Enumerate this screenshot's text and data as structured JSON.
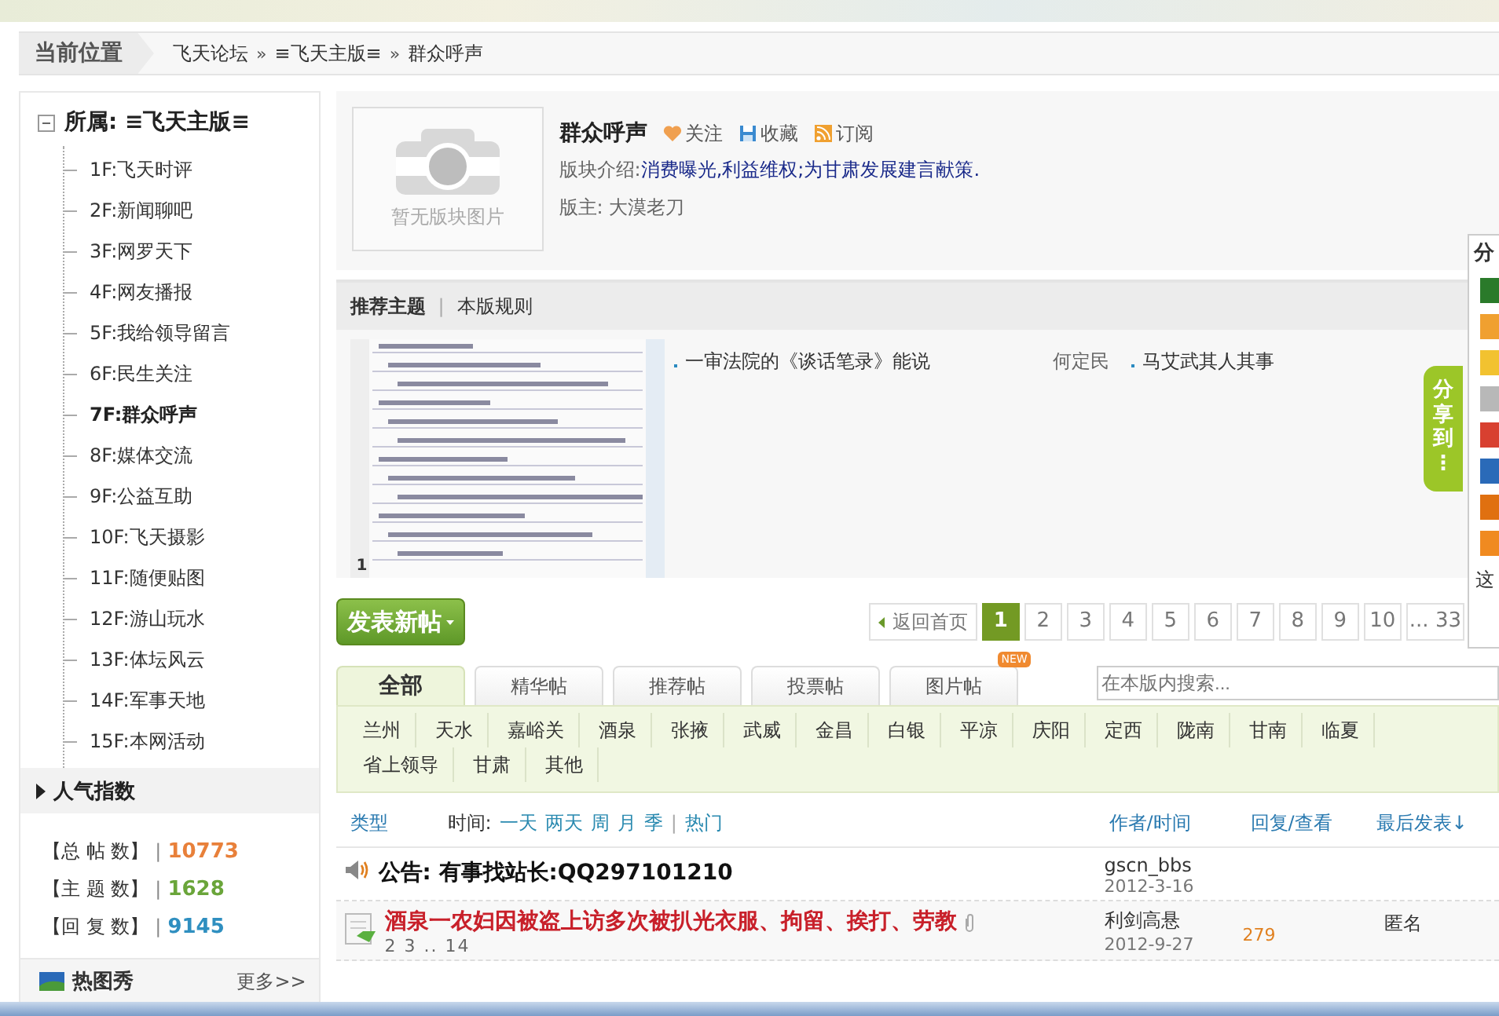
{
  "breadcrumb": {
    "label": "当前位置",
    "crumbs": [
      {
        "kind": "link",
        "text": "飞天论坛"
      },
      {
        "kind": "separator",
        "text": "»"
      },
      {
        "kind": "link",
        "text": "≡飞天主版≡"
      },
      {
        "kind": "separator",
        "text": "»"
      },
      {
        "kind": "link",
        "text": "群众呼声"
      }
    ]
  },
  "sidebar": {
    "title": "所属: ≡飞天主版≡",
    "expanded": true,
    "items": [
      {
        "label": "1F:飞天时评",
        "selected": false
      },
      {
        "label": "2F:新闻聊吧",
        "selected": false
      },
      {
        "label": "3F:网罗天下",
        "selected": false
      },
      {
        "label": "4F:网友播报",
        "selected": false
      },
      {
        "label": "5F:我给领导留言",
        "selected": false
      },
      {
        "label": "6F:民生关注",
        "selected": false
      },
      {
        "label": "7F:群众呼声",
        "selected": true
      },
      {
        "label": "8F:媒体交流",
        "selected": false
      },
      {
        "label": "9F:公益互助",
        "selected": false
      },
      {
        "label": "10F:飞天摄影",
        "selected": false
      },
      {
        "label": "11F:随便贴图",
        "selected": false
      },
      {
        "label": "12F:游山玩水",
        "selected": false
      },
      {
        "label": "13F:体坛风云",
        "selected": false
      },
      {
        "label": "14F:军事天地",
        "selected": false
      },
      {
        "label": "15F:本网活动",
        "selected": false
      }
    ]
  },
  "popularity": {
    "title": "人气指数",
    "expanded": false,
    "stats": [
      {
        "label": "【总 帖 数】",
        "separator": "|",
        "value": "10773",
        "color": "#e8803a"
      },
      {
        "label": "【主 题 数】",
        "separator": "|",
        "value": "1628",
        "color": "#6aa53a"
      },
      {
        "label": "【回 复 数】",
        "separator": "|",
        "value": "9145",
        "color": "#2f8fc0"
      }
    ]
  },
  "hot_pics": {
    "title": "热图秀",
    "more": "更多>>"
  },
  "forum": {
    "image_caption": "暂无版块图片",
    "name": "群众呼声",
    "actions": [
      {
        "kind": "heart",
        "label": "关注"
      },
      {
        "kind": "disk",
        "label": "收藏"
      },
      {
        "kind": "rss",
        "label": "订阅"
      }
    ],
    "intro_label": "版块介绍:",
    "intro": "消费曝光,利益维权;为甘肃发展建言献策.",
    "moderator": "版主: 大漠老刀"
  },
  "recommend": {
    "tab_separator": "|",
    "tabs": [
      {
        "label": "推荐主题",
        "selected": true
      },
      {
        "label": "本版规则",
        "selected": false
      }
    ],
    "image_index": "1",
    "topics": [
      {
        "title": "一审法院的《谈话笔录》能说",
        "author": "何定民"
      },
      {
        "title": "马艾武其人其事"
      }
    ]
  },
  "post_button": "发表新帖",
  "pager": {
    "back": "返回首页",
    "pages": [
      {
        "label": "1",
        "selected": true
      },
      {
        "label": "2",
        "selected": false
      },
      {
        "label": "3",
        "selected": false
      },
      {
        "label": "4",
        "selected": false
      },
      {
        "label": "5",
        "selected": false
      },
      {
        "label": "6",
        "selected": false
      },
      {
        "label": "7",
        "selected": false
      },
      {
        "label": "8",
        "selected": false
      },
      {
        "label": "9",
        "selected": false
      },
      {
        "label": "10",
        "selected": false
      },
      {
        "label": "... 33",
        "selected": false
      }
    ]
  },
  "filter_tabs": [
    {
      "label": "全部",
      "selected": true
    },
    {
      "label": "精华帖",
      "selected": false
    },
    {
      "label": "推荐帖",
      "selected": false
    },
    {
      "label": "投票帖",
      "selected": false
    },
    {
      "label": "图片帖",
      "selected": false,
      "badge": "NEW"
    }
  ],
  "search": {
    "placeholder": "在本版内搜索..."
  },
  "regions": [
    "兰州",
    "天水",
    "嘉峪关",
    "酒泉",
    "张掖",
    "武威",
    "金昌",
    "白银",
    "平凉",
    "庆阳",
    "定西",
    "陇南",
    "甘南",
    "临夏",
    "省上领导",
    "甘肃",
    "其他"
  ],
  "list_header": {
    "type": "类型",
    "time_label": "时间:",
    "time_filters": [
      "一天",
      "两天",
      "周",
      "月",
      "季"
    ],
    "separator": "|",
    "hot": "热门",
    "author_time": "作者/时间",
    "replies_views": "回复/查看",
    "last_post": "最后发表↓"
  },
  "threads": [
    {
      "kind": "announcement",
      "title": "公告: 有事找站长:QQ297101210",
      "author": "gscn_bbs",
      "date": "2012-3-16"
    },
    {
      "kind": "topic",
      "title": "酒泉一农妇因被盗上访多次被扒光衣服、拘留、挨打、劳教",
      "pages": "2 3 .. 14",
      "attachment": true,
      "author": "利剑高悬",
      "date": "2012-9-27",
      "replies": "279",
      "last_author": "匿名"
    }
  ],
  "share": {
    "title": "分",
    "tab": "分享到⋮",
    "footer": "这",
    "services": [
      {
        "color": "#2a7a2a"
      },
      {
        "color": "#f0a030"
      },
      {
        "color": "#f2c230"
      },
      {
        "color": "#b8b8b8"
      },
      {
        "color": "#d84030"
      },
      {
        "color": "#2a6ab8"
      },
      {
        "color": "#e07010"
      },
      {
        "color": "#f08a20"
      }
    ]
  }
}
